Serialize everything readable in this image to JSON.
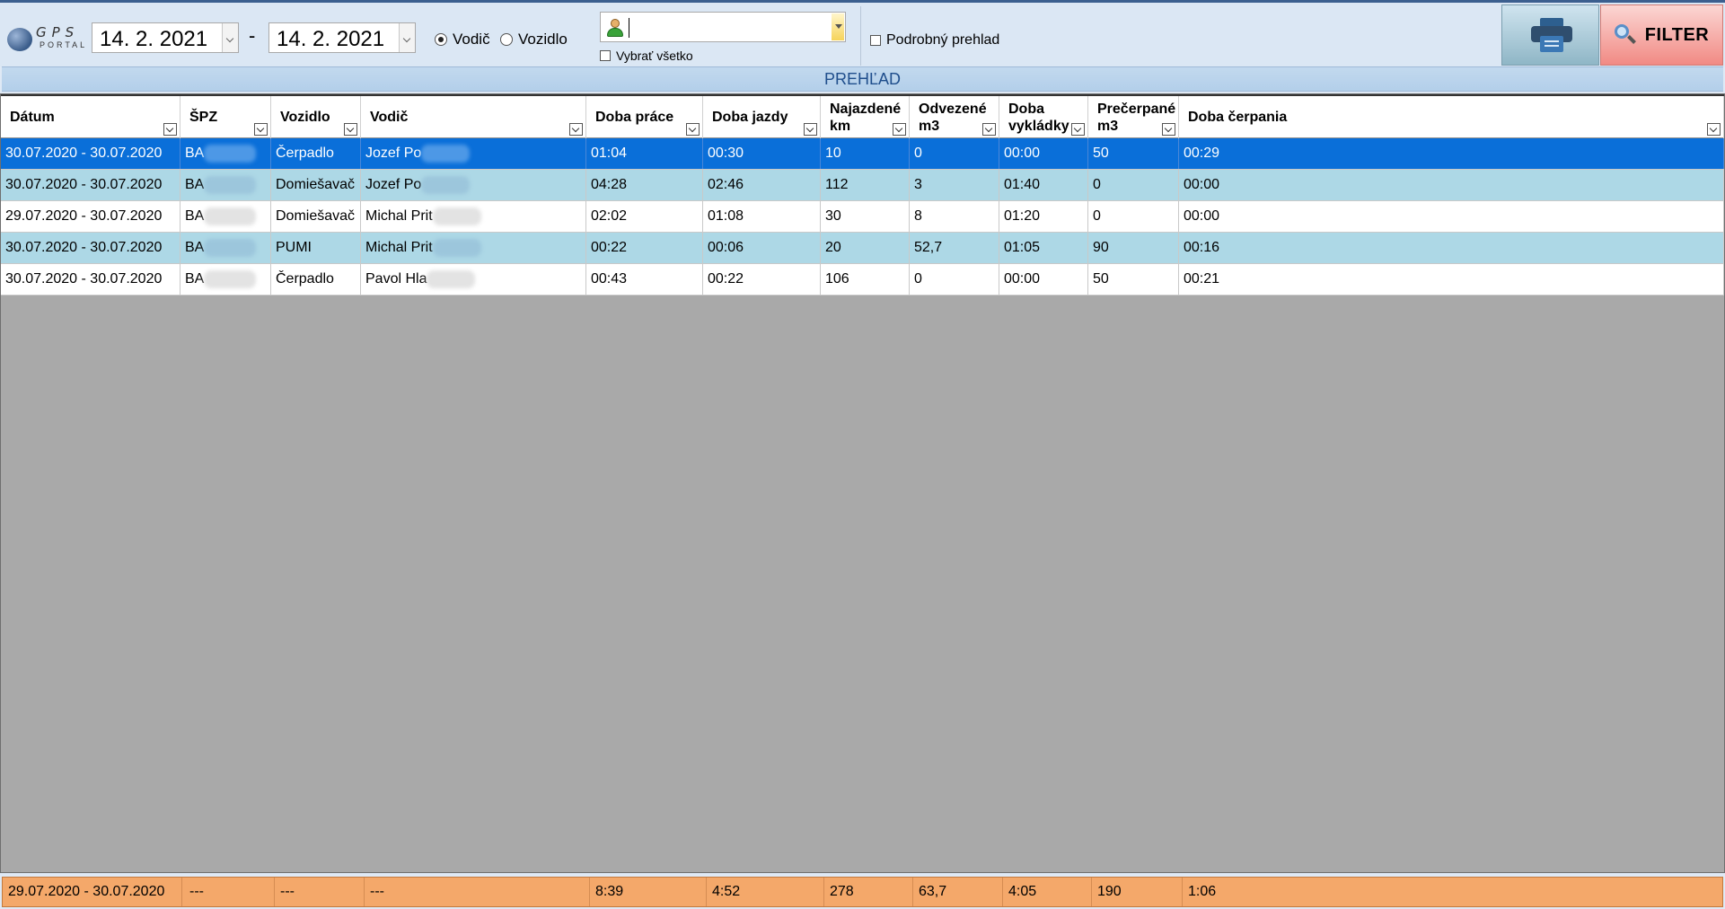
{
  "toolbar": {
    "logo": {
      "gps": "GPS",
      "portal": "PORTAL"
    },
    "date_from": "14. 2. 2021",
    "date_separator": "-",
    "date_to": "14. 2. 2021",
    "mode_options": [
      {
        "label": "Vodič",
        "selected": true
      },
      {
        "label": "Vozidlo",
        "selected": false
      }
    ],
    "person_value": "",
    "select_all_label": "Vybrať všetko",
    "select_all_checked": false,
    "detailed_label": "Podrobný prehlad",
    "detailed_checked": false,
    "print_icon": "printer-icon",
    "filter_label": "FILTER",
    "filter_icon": "magnifier-icon"
  },
  "overview_title": "PREHĽAD",
  "grid": {
    "columns": [
      {
        "label": "Dátum"
      },
      {
        "label": "ŠPZ"
      },
      {
        "label": "Vozidlo"
      },
      {
        "label": "Vodič"
      },
      {
        "label": "Doba práce"
      },
      {
        "label": "Doba jazdy"
      },
      {
        "label": "Najazdené km"
      },
      {
        "label": "Odvezené m3"
      },
      {
        "label": "Doba vykládky"
      },
      {
        "label": "Prečerpané m3"
      },
      {
        "label": "Doba čerpania"
      }
    ],
    "rows": [
      {
        "selected": true,
        "bg": "#0a6fd9",
        "cells": [
          "30.07.2020 - 30.07.2020",
          "BA",
          "Čerpadlo",
          "Jozef Po",
          "01:04",
          "00:30",
          "10",
          "0",
          "00:00",
          "50",
          "00:29"
        ]
      },
      {
        "selected": false,
        "bg": "#add8e6",
        "cells": [
          "30.07.2020 - 30.07.2020",
          "BA",
          "Domiešavač",
          "Jozef Po",
          "04:28",
          "02:46",
          "112",
          "3",
          "01:40",
          "0",
          "00:00"
        ]
      },
      {
        "selected": false,
        "bg": "#ffffff",
        "cells": [
          "29.07.2020 - 30.07.2020",
          "BA",
          "Domiešavač",
          "Michal Prit",
          "02:02",
          "01:08",
          "30",
          "8",
          "01:20",
          "0",
          "00:00"
        ]
      },
      {
        "selected": false,
        "bg": "#add8e6",
        "cells": [
          "30.07.2020 - 30.07.2020",
          "BA",
          "PUMI",
          "Michal Prit",
          "00:22",
          "00:06",
          "20",
          "52,7",
          "01:05",
          "90",
          "00:16"
        ]
      },
      {
        "selected": false,
        "bg": "#ffffff",
        "cells": [
          "30.07.2020 - 30.07.2020",
          "BA",
          "Čerpadlo",
          "Pavol Hla",
          "00:43",
          "00:22",
          "106",
          "0",
          "00:00",
          "50",
          "00:21"
        ]
      }
    ]
  },
  "totals": [
    "29.07.2020 - 30.07.2020",
    "---",
    "---",
    "---",
    "8:39",
    "4:52",
    "278",
    "63,7",
    "4:05",
    "190",
    "1:06"
  ],
  "colors": {
    "selected_row": "#0a6fd9",
    "alt_row": "#add8e6",
    "totals_bg": "#f4a86a",
    "filter_button": "#f18a84",
    "print_button": "#8fb6c6",
    "overview_text": "#1f4e8c"
  }
}
